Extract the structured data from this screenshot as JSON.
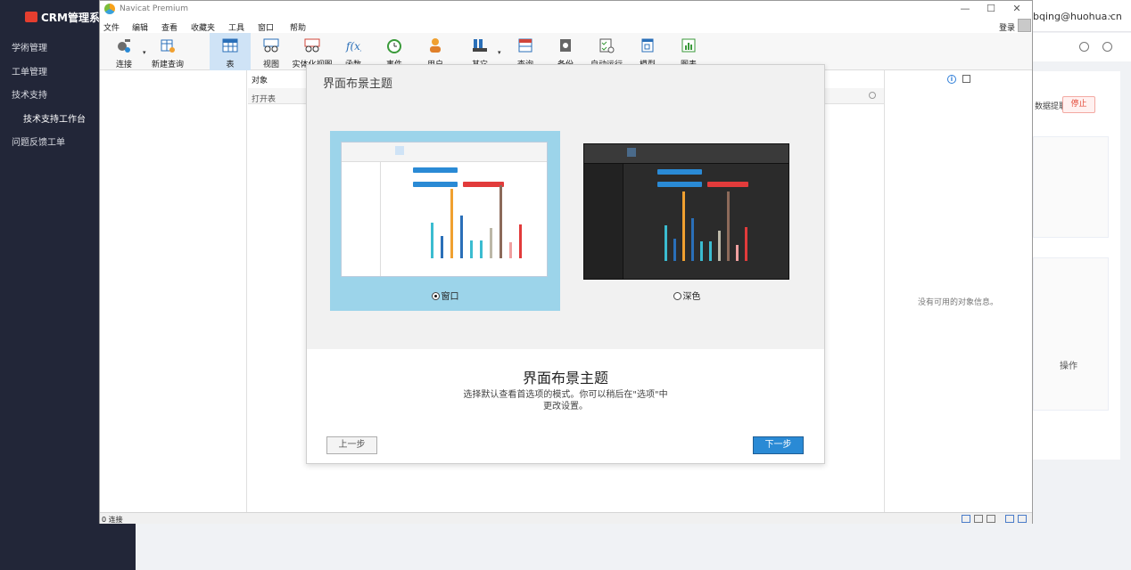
{
  "crm": {
    "logo": "CRM管理系统",
    "nav": [
      "学術管理",
      "工单管理",
      "技术支持",
      "技术支持工作台",
      "问题反馈工单"
    ],
    "user": "bqing@huohua.cn",
    "extract_label": "数据提取:",
    "stop_button": "停止",
    "operation_header": "操作"
  },
  "navicat": {
    "title": "Navicat Premium",
    "menu": [
      "文件",
      "编辑",
      "查看",
      "收藏夹",
      "工具",
      "窗口",
      "帮助"
    ],
    "login": "登录",
    "toolbar": [
      {
        "label": "连接",
        "icon": "connection-icon"
      },
      {
        "label": "新建查询",
        "icon": "new-query-icon"
      },
      {
        "label": "表",
        "icon": "table-icon"
      },
      {
        "label": "视图",
        "icon": "view-icon"
      },
      {
        "label": "实体化视图",
        "icon": "materialized-view-icon"
      },
      {
        "label": "函数",
        "icon": "function-icon"
      },
      {
        "label": "事件",
        "icon": "event-icon"
      },
      {
        "label": "用户",
        "icon": "user-icon"
      },
      {
        "label": "其它",
        "icon": "others-icon"
      },
      {
        "label": "查询",
        "icon": "query-icon"
      },
      {
        "label": "备份",
        "icon": "backup-icon"
      },
      {
        "label": "自动运行",
        "icon": "automation-icon"
      },
      {
        "label": "模型",
        "icon": "model-icon"
      },
      {
        "label": "图表",
        "icon": "chart-icon"
      }
    ],
    "objects_tab": "对象",
    "open_table": "打开表",
    "no_object_info": "没有可用的对象信息。",
    "status": "0 连接"
  },
  "dialog": {
    "header": "界面布景主题",
    "themes": [
      {
        "label": "窗口",
        "selected": true
      },
      {
        "label": "深色",
        "selected": false
      }
    ],
    "title": "界面布景主题",
    "description_line1": "选择默认查看首选项的模式。你可以稍后在\"选项\"中",
    "description_line2": "更改设置。",
    "back_button": "上一步",
    "next_button": "下一步",
    "colors": {
      "light_card_bg": "#9cd4ea",
      "next_button_bg": "#2a8ad5",
      "stop_button": "#e34d3c"
    }
  }
}
